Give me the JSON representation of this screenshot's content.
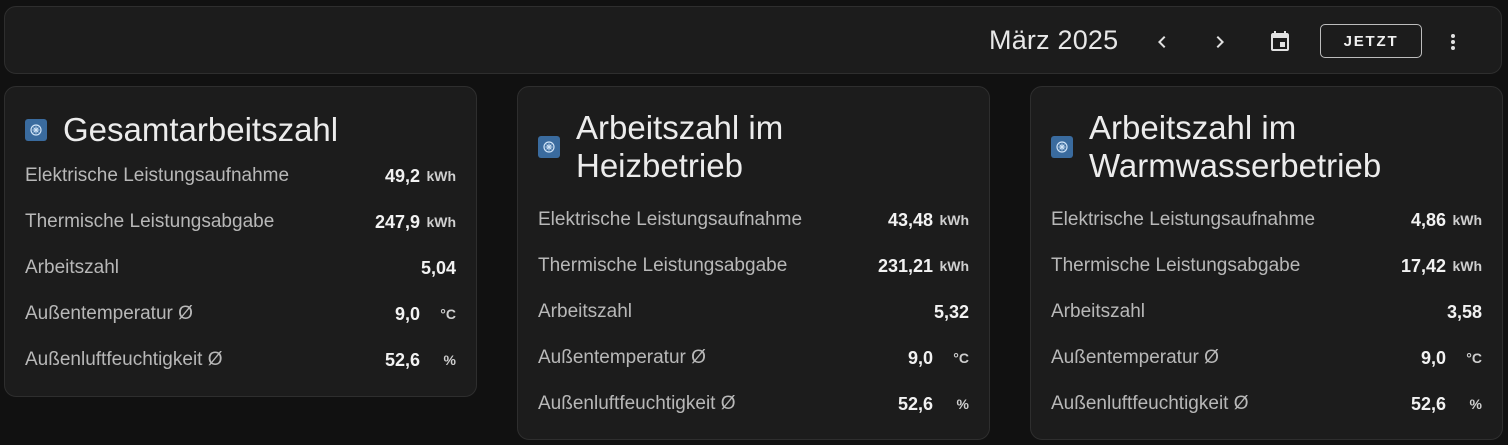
{
  "header": {
    "period": "März 2025",
    "now_label": "JETZT",
    "icons": [
      "chevron-left-icon",
      "chevron-right-icon",
      "calendar-icon",
      "more-vert-icon"
    ]
  },
  "colors": {
    "background": "#111111",
    "card": "#1c1c1c",
    "icon_badge": "#3a6b9e"
  },
  "cards": [
    {
      "title": "Gesamtarbeitszahl",
      "icon": "heat-pump-icon",
      "rows": [
        {
          "label": "Elektrische Leistungsaufnahme",
          "value": "49,2",
          "unit": "kWh"
        },
        {
          "label": "Thermische Leistungsabgabe",
          "value": "247,9",
          "unit": "kWh"
        },
        {
          "label": "Arbeitszahl",
          "value": "5,04",
          "unit": ""
        },
        {
          "label": "Außentemperatur Ø",
          "value": "9,0",
          "unit": "°C"
        },
        {
          "label": "Außenluftfeuchtigkeit Ø",
          "value": "52,6",
          "unit": "%"
        }
      ]
    },
    {
      "title_line1": "Arbeitszahl im",
      "title_line2": "Heizbetrieb",
      "icon": "heat-pump-icon",
      "rows": [
        {
          "label": "Elektrische Leistungsaufnahme",
          "value": "43,48",
          "unit": "kWh"
        },
        {
          "label": "Thermische Leistungsabgabe",
          "value": "231,21",
          "unit": "kWh"
        },
        {
          "label": "Arbeitszahl",
          "value": "5,32",
          "unit": ""
        },
        {
          "label": "Außentemperatur Ø",
          "value": "9,0",
          "unit": "°C"
        },
        {
          "label": "Außenluftfeuchtigkeit Ø",
          "value": "52,6",
          "unit": "%"
        }
      ]
    },
    {
      "title_line1": "Arbeitszahl im",
      "title_line2": "Warmwasserbetrieb",
      "icon": "heat-pump-icon",
      "rows": [
        {
          "label": "Elektrische Leistungsaufnahme",
          "value": "4,86",
          "unit": "kWh"
        },
        {
          "label": "Thermische Leistungsabgabe",
          "value": "17,42",
          "unit": "kWh"
        },
        {
          "label": "Arbeitszahl",
          "value": "3,58",
          "unit": ""
        },
        {
          "label": "Außentemperatur Ø",
          "value": "9,0",
          "unit": "°C"
        },
        {
          "label": "Außenluftfeuchtigkeit Ø",
          "value": "52,6",
          "unit": "%"
        }
      ]
    }
  ]
}
